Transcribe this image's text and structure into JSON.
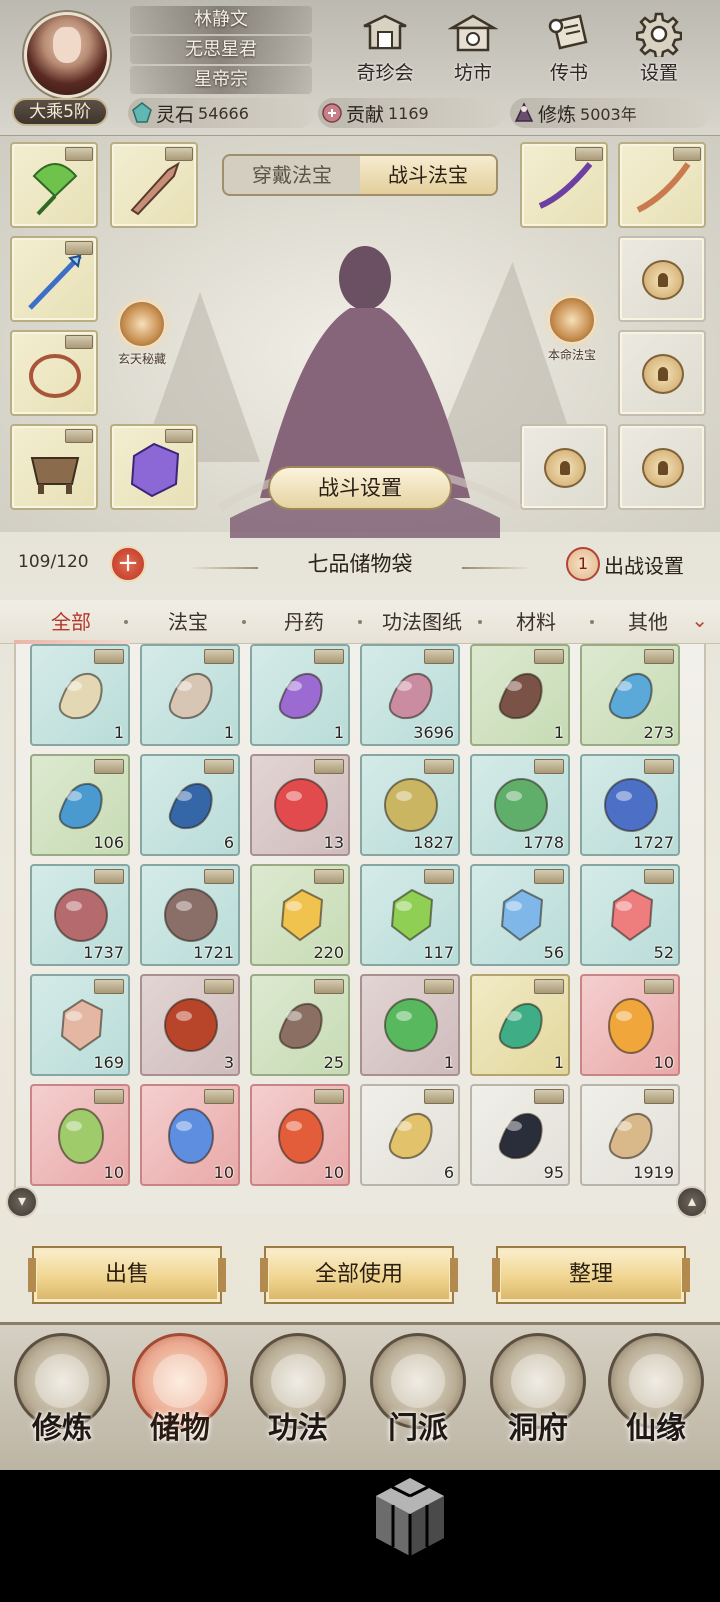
{
  "profile": {
    "name": "林静文",
    "title": "无思星君",
    "sect": "星帝宗",
    "realm": "大乘5阶"
  },
  "header_buttons": [
    {
      "label": "奇珍会",
      "icon": "treasure-pavilion-icon"
    },
    {
      "label": "坊市",
      "icon": "market-icon"
    },
    {
      "label": "传书",
      "icon": "letter-scroll-icon"
    },
    {
      "label": "设置",
      "icon": "gear-icon"
    }
  ],
  "resources": [
    {
      "key": "灵石",
      "value": "54666",
      "icon": "spirit-stone-icon",
      "color": "#5fb8b2"
    },
    {
      "key": "贡献",
      "value": "1169",
      "icon": "contribution-icon",
      "color": "#c7808a"
    },
    {
      "key": "修炼",
      "value": "5003年",
      "icon": "cultivation-icon",
      "color": "#6b4d6e"
    }
  ],
  "equip": {
    "tabs": [
      "穿戴法宝",
      "战斗法宝"
    ],
    "active_tab": 1,
    "left_orb": "玄天秘藏",
    "right_orb": "本命法宝",
    "battle_settings": "战斗设置"
  },
  "bag": {
    "capacity": "109/120",
    "title": "七品储物袋",
    "deploy_count": "1",
    "deploy_label": "出战设置"
  },
  "categories": [
    "全部",
    "法宝",
    "丹药",
    "功法图纸",
    "材料",
    "其他"
  ],
  "active_category": 0,
  "items": [
    {
      "name": "scroll-item",
      "count": "1",
      "rarity": "blue",
      "color": "#e4d7b4"
    },
    {
      "name": "dagger-item",
      "count": "1",
      "rarity": "blue",
      "color": "#d8c6b4"
    },
    {
      "name": "purple-ring-item",
      "count": "1",
      "rarity": "blue",
      "color": "#9b6bd1"
    },
    {
      "name": "ore-cloth-item",
      "count": "3696",
      "rarity": "blue",
      "color": "#c98ca0"
    },
    {
      "name": "gourd-item",
      "count": "1",
      "rarity": "green",
      "color": "#7a5246"
    },
    {
      "name": "water-drop-item",
      "count": "273",
      "rarity": "green",
      "color": "#5aa9d8"
    },
    {
      "name": "wave-essence-item",
      "count": "106",
      "rarity": "green",
      "color": "#4a9ad0"
    },
    {
      "name": "deep-wave-item",
      "count": "6",
      "rarity": "blue",
      "color": "#3466a8"
    },
    {
      "name": "red-pearl-item",
      "count": "13",
      "rarity": "purple",
      "color": "#e24b4e"
    },
    {
      "name": "gold-pearl-item",
      "count": "1827",
      "rarity": "blue",
      "color": "#c9b562"
    },
    {
      "name": "green-pearl-item",
      "count": "1778",
      "rarity": "blue",
      "color": "#5fae6a"
    },
    {
      "name": "blue-pearl-item",
      "count": "1727",
      "rarity": "blue",
      "color": "#4b70c6"
    },
    {
      "name": "rose-pearl-item",
      "count": "1737",
      "rarity": "blue",
      "color": "#b56a6e"
    },
    {
      "name": "taupe-pearl-item",
      "count": "1721",
      "rarity": "blue",
      "color": "#8a6e68"
    },
    {
      "name": "amber-crystal-item",
      "count": "220",
      "rarity": "green",
      "color": "#f0c24e"
    },
    {
      "name": "jade-crystal-item",
      "count": "117",
      "rarity": "blue",
      "color": "#8fd054"
    },
    {
      "name": "ice-crystal-item",
      "count": "56",
      "rarity": "blue",
      "color": "#7fb8e8"
    },
    {
      "name": "ruby-crystal-item",
      "count": "52",
      "rarity": "blue",
      "color": "#ee7d7d"
    },
    {
      "name": "pale-crystal-item",
      "count": "169",
      "rarity": "blue",
      "color": "#e3b7a2"
    },
    {
      "name": "flame-orb-item",
      "count": "3",
      "rarity": "purple",
      "color": "#b8452a"
    },
    {
      "name": "whip-item",
      "count": "25",
      "rarity": "green",
      "color": "#8b6f62"
    },
    {
      "name": "emerald-orb-item",
      "count": "1",
      "rarity": "purple",
      "color": "#58b85e"
    },
    {
      "name": "taiji-jade-item",
      "count": "1",
      "rarity": "gold",
      "color": "#3fae86"
    },
    {
      "name": "amber-egg-item",
      "count": "10",
      "rarity": "red",
      "color": "#f0a63b"
    },
    {
      "name": "jade-egg-item",
      "count": "10",
      "rarity": "red",
      "color": "#9fcb6a"
    },
    {
      "name": "sapphire-egg-item",
      "count": "10",
      "rarity": "red",
      "color": "#5d8ee0"
    },
    {
      "name": "fire-egg-item",
      "count": "10",
      "rarity": "red",
      "color": "#e45d3a"
    },
    {
      "name": "paper-charm-item",
      "count": "6",
      "rarity": "white",
      "color": "#e2c26a"
    },
    {
      "name": "iron-ore-item",
      "count": "95",
      "rarity": "white",
      "color": "#2a2e3a"
    },
    {
      "name": "ginseng-item",
      "count": "1919",
      "rarity": "white",
      "color": "#d9b98a"
    }
  ],
  "actions": [
    "出售",
    "全部使用",
    "整理"
  ],
  "nav": [
    {
      "label": "修炼",
      "icon": "meditation-icon"
    },
    {
      "label": "储物",
      "icon": "storage-bag-icon"
    },
    {
      "label": "功法",
      "icon": "technique-scroll-icon"
    },
    {
      "label": "门派",
      "icon": "sect-gate-icon"
    },
    {
      "label": "洞府",
      "icon": "cave-mountain-icon"
    },
    {
      "label": "仙缘",
      "icon": "immortal-fate-icon"
    }
  ],
  "active_nav": 1
}
